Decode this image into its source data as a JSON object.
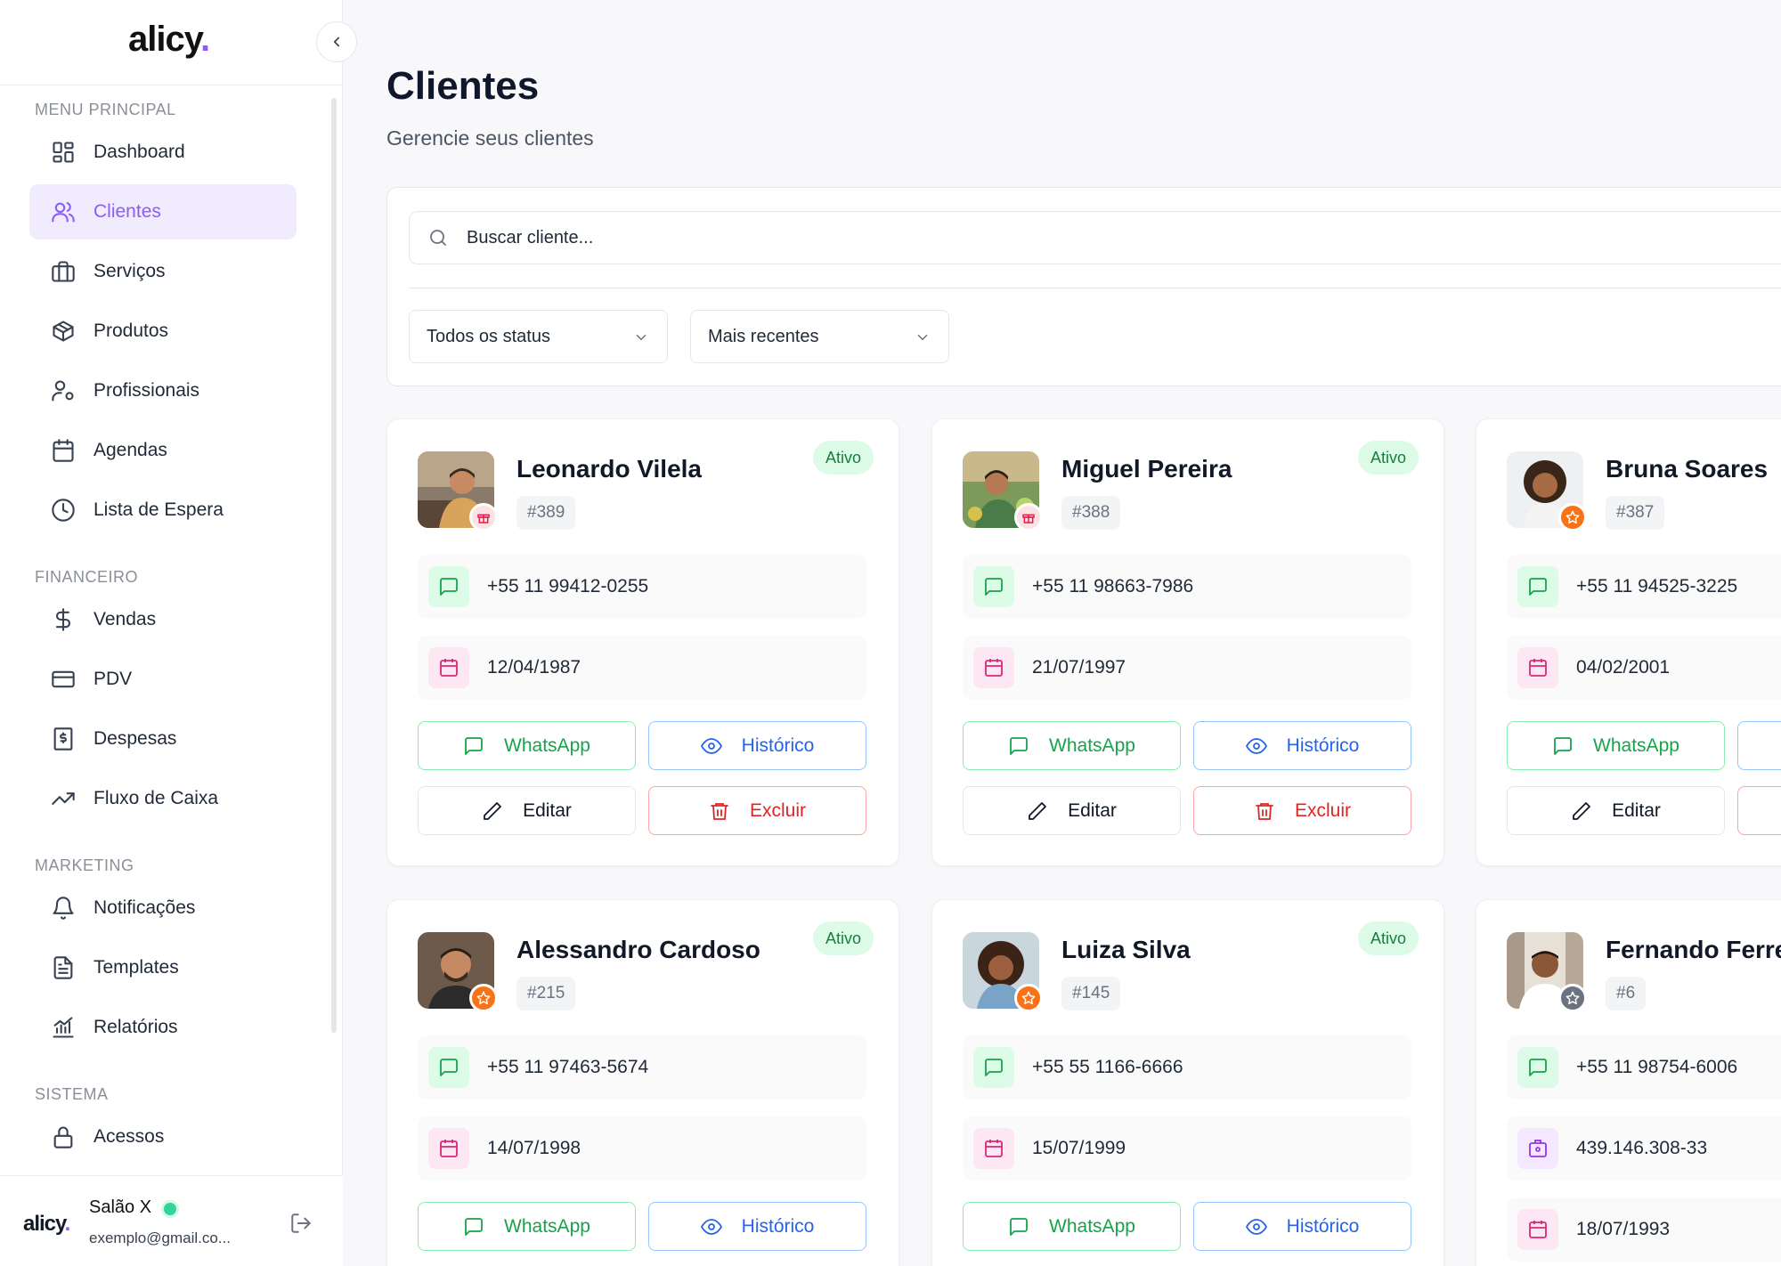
{
  "app": {
    "logo": "alicy",
    "logo_dot": "."
  },
  "sidebar": {
    "sections": [
      {
        "label": "MENU PRINCIPAL",
        "items": [
          {
            "label": "Dashboard",
            "icon": "dashboard-icon"
          },
          {
            "label": "Clientes",
            "icon": "users-icon",
            "active": true
          },
          {
            "label": "Serviços",
            "icon": "briefcase-icon"
          },
          {
            "label": "Produtos",
            "icon": "package-icon"
          },
          {
            "label": "Profissionais",
            "icon": "user-cog-icon"
          },
          {
            "label": "Agendas",
            "icon": "calendar-icon"
          },
          {
            "label": "Lista de Espera",
            "icon": "clock-icon"
          }
        ]
      },
      {
        "label": "FINANCEIRO",
        "items": [
          {
            "label": "Vendas",
            "icon": "dollar-icon"
          },
          {
            "label": "PDV",
            "icon": "credit-card-icon"
          },
          {
            "label": "Despesas",
            "icon": "receipt-icon"
          },
          {
            "label": "Fluxo de Caixa",
            "icon": "trending-up-icon"
          }
        ]
      },
      {
        "label": "MARKETING",
        "items": [
          {
            "label": "Notificações",
            "icon": "bell-icon"
          },
          {
            "label": "Templates",
            "icon": "file-text-icon"
          },
          {
            "label": "Relatórios",
            "icon": "bar-chart-icon"
          }
        ]
      },
      {
        "label": "SISTEMA",
        "items": [
          {
            "label": "Acessos",
            "icon": "lock-icon"
          }
        ]
      }
    ]
  },
  "user": {
    "name": "Salão X",
    "email": "exemplo@gmail.co...",
    "status_color": "#34d399"
  },
  "page": {
    "title": "Clientes",
    "subtitle": "Gerencie seus clientes"
  },
  "filters": {
    "search_placeholder": "Buscar cliente...",
    "status_select": "Todos os status",
    "sort_select": "Mais recentes"
  },
  "actions": {
    "whatsapp": "WhatsApp",
    "history": "Histórico",
    "edit": "Editar",
    "delete": "Excluir"
  },
  "clients": [
    {
      "name": "Leonardo Vilela",
      "id": "#389",
      "status": "Ativo",
      "phone": "+55 11 99412-0255",
      "birthdate": "12/04/1987",
      "badge": "gift"
    },
    {
      "name": "Miguel Pereira",
      "id": "#388",
      "status": "Ativo",
      "phone": "+55 11 98663-7986",
      "birthdate": "21/07/1997",
      "badge": "gift"
    },
    {
      "name": "Bruna Soares",
      "id": "#387",
      "status": "",
      "phone": "+55 11 94525-3225",
      "birthdate": "04/02/2001",
      "badge": "star"
    },
    {
      "name": "Alessandro Cardoso",
      "id": "#215",
      "status": "Ativo",
      "phone": "+55 11 97463-5674",
      "birthdate": "14/07/1998",
      "badge": "star"
    },
    {
      "name": "Luiza Silva",
      "id": "#145",
      "status": "Ativo",
      "phone": "+55 55 1166-6666",
      "birthdate": "15/07/1999",
      "badge": "star"
    },
    {
      "name": "Fernando Ferrei",
      "id": "#6",
      "status": "",
      "phone": "+55 11 98754-6006",
      "document": "439.146.308-33",
      "birthdate": "18/07/1993",
      "badge": "star-gray"
    }
  ]
}
